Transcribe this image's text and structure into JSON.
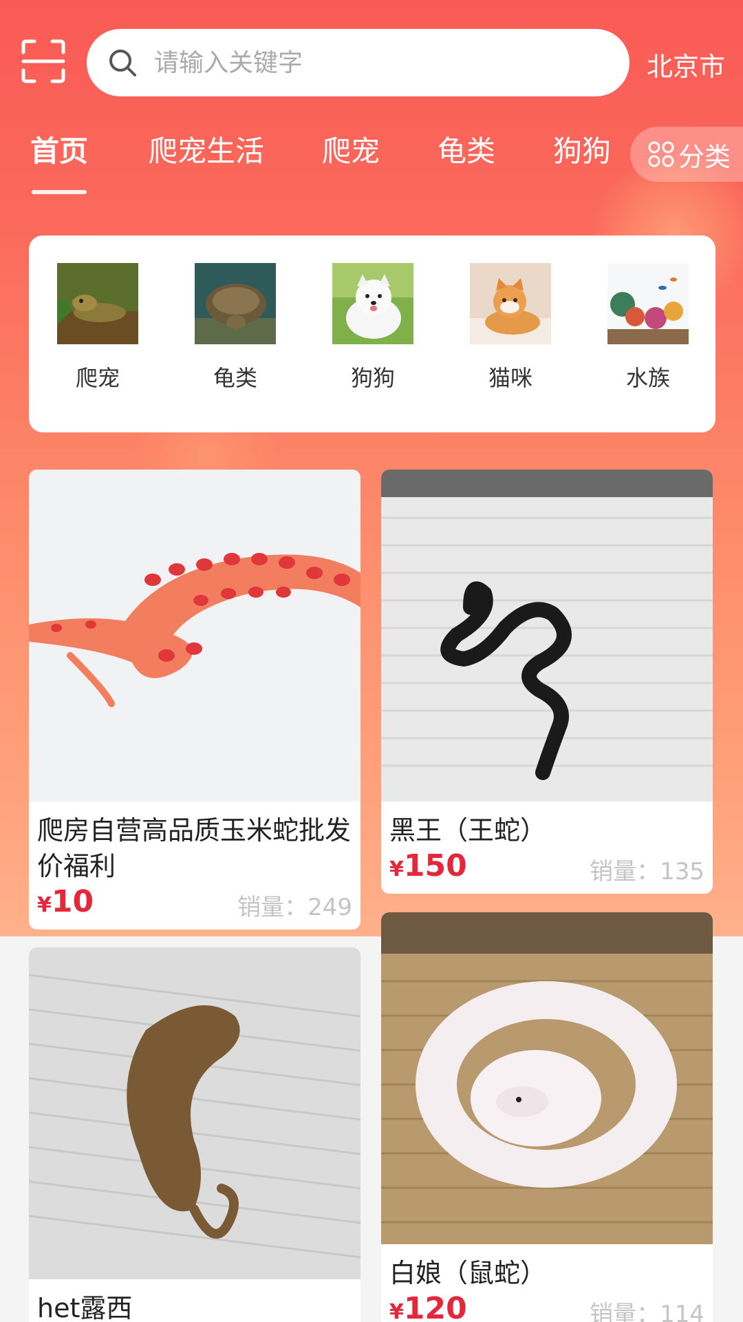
{
  "header": {
    "search_placeholder": "请输入关键字",
    "city": "北京市"
  },
  "tabs": [
    {
      "label": "首页",
      "active": true
    },
    {
      "label": "爬宠生活",
      "active": false
    },
    {
      "label": "爬宠",
      "active": false
    },
    {
      "label": "龟类",
      "active": false
    },
    {
      "label": "狗狗",
      "active": false
    }
  ],
  "category_button": {
    "label": "分类",
    "icon": "grid-icon"
  },
  "categories": [
    {
      "label": "爬宠",
      "icon": "reptile-thumb"
    },
    {
      "label": "龟类",
      "icon": "turtle-thumb"
    },
    {
      "label": "狗狗",
      "icon": "dog-thumb"
    },
    {
      "label": "猫咪",
      "icon": "cat-thumb"
    },
    {
      "label": "水族",
      "icon": "aquarium-thumb"
    }
  ],
  "products": [
    {
      "title": "爬房自营高品质玉米蛇批发价福利",
      "currency": "¥",
      "price": "10",
      "sales_label": "销量：",
      "sales": "249"
    },
    {
      "title": "黑王（王蛇）",
      "currency": "¥",
      "price": "150",
      "sales_label": "销量：",
      "sales": "135"
    },
    {
      "title": "het露西",
      "currency": "¥",
      "price": "",
      "sales_label": "",
      "sales": ""
    },
    {
      "title": "白娘（鼠蛇）",
      "currency": "¥",
      "price": "120",
      "sales_label": "销量：",
      "sales": "114"
    }
  ],
  "colors": {
    "header_top": "#fa5a55",
    "header_bottom": "#ffb18b",
    "price": "#e5273c",
    "sales": "#c4c4c4"
  }
}
